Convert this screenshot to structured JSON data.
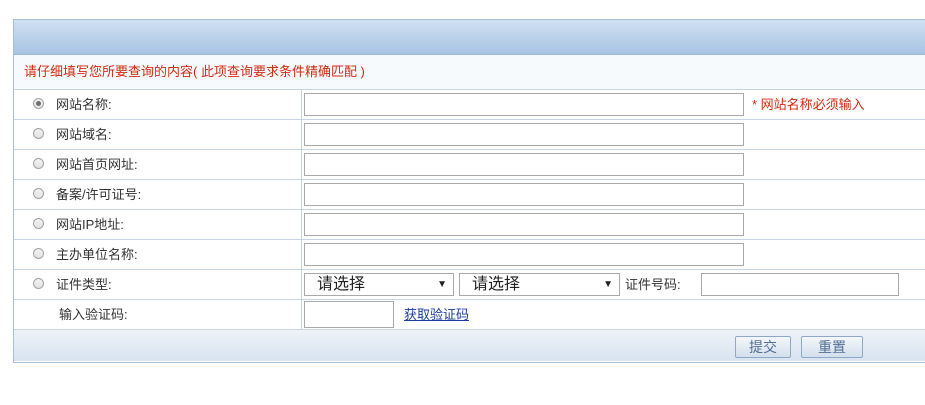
{
  "notice": "请仔细填写您所要查询的内容( 此项查询要求条件精确匹配 )",
  "fields": [
    {
      "label": "网站名称:",
      "checked": true,
      "value": ""
    },
    {
      "label": "网站域名:",
      "checked": false,
      "value": ""
    },
    {
      "label": "网站首页网址:",
      "checked": false,
      "value": ""
    },
    {
      "label": "备案/许可证号:",
      "checked": false,
      "value": ""
    },
    {
      "label": "网站IP地址:",
      "checked": false,
      "value": ""
    },
    {
      "label": "主办单位名称:",
      "checked": false,
      "value": ""
    }
  ],
  "required_message": "* 网站名称必须输入",
  "cert": {
    "label": "证件类型:",
    "select1": "请选择",
    "select2": "请选择",
    "number_label": "证件号码:",
    "number_value": ""
  },
  "captcha": {
    "label": "输入验证码:",
    "value": "",
    "link": "获取验证码"
  },
  "buttons": {
    "submit": "提交",
    "reset": "重置"
  },
  "icons": {
    "dropdown": "▼"
  },
  "colors": {
    "required": "#d22b12",
    "link": "#1a3d9e",
    "header": "#a9c4e3"
  }
}
